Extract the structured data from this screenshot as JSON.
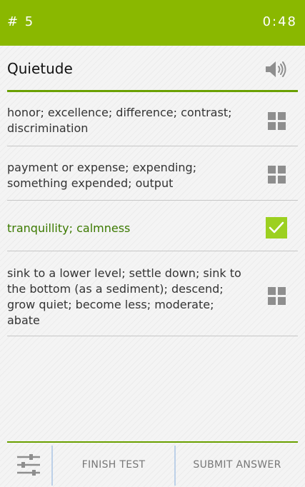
{
  "header": {
    "question_number": "# 5",
    "timer": "0:48",
    "background_color": "#8ab800"
  },
  "question": {
    "word": "Quietude",
    "audio_icon": "speaker-icon"
  },
  "options": [
    {
      "text": "honor; excellence; difference; contrast; discrimination",
      "state": "unselected",
      "icon": "grid-icon"
    },
    {
      "text": "payment or expense; expending; something expended; output",
      "state": "unselected",
      "icon": "grid-icon"
    },
    {
      "text": "tranquillity; calmness",
      "state": "selected",
      "icon": "checkmark-icon"
    },
    {
      "text": "sink to a lower level; settle down; sink to the bottom (as a sediment); descend; grow quiet; become less; moderate; abate",
      "state": "unselected",
      "icon": "grid-icon"
    }
  ],
  "bottom_bar": {
    "settings_icon": "sliders-icon",
    "finish_label": "FINISH TEST",
    "submit_label": "SUBMIT ANSWER"
  },
  "colors": {
    "accent": "#8ab800",
    "selected_text": "#3c7a00",
    "checkbox": "#9cd020"
  }
}
